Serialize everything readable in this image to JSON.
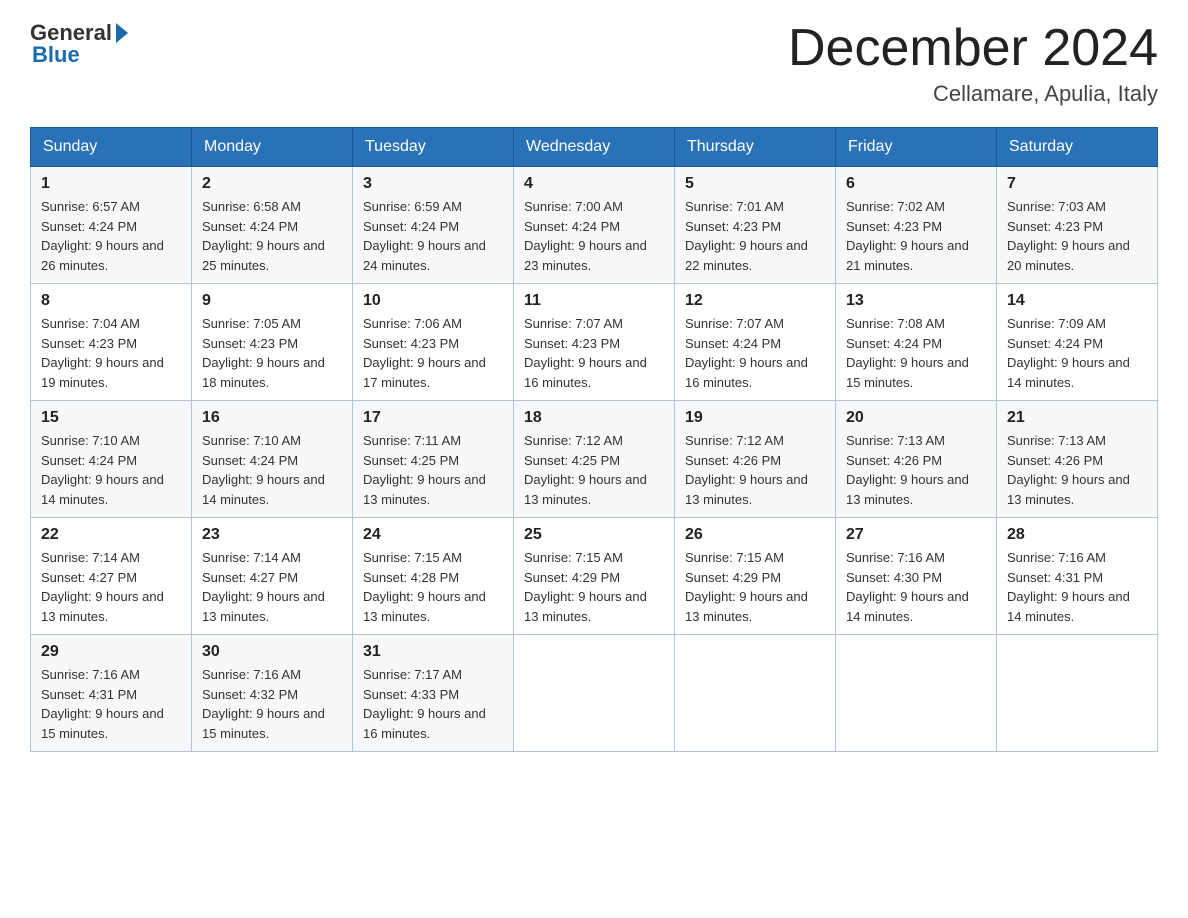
{
  "logo": {
    "general": "General",
    "blue": "Blue"
  },
  "header": {
    "title": "December 2024",
    "location": "Cellamare, Apulia, Italy"
  },
  "days_of_week": [
    "Sunday",
    "Monday",
    "Tuesday",
    "Wednesday",
    "Thursday",
    "Friday",
    "Saturday"
  ],
  "weeks": [
    [
      {
        "day": "1",
        "sunrise": "6:57 AM",
        "sunset": "4:24 PM",
        "daylight": "9 hours and 26 minutes."
      },
      {
        "day": "2",
        "sunrise": "6:58 AM",
        "sunset": "4:24 PM",
        "daylight": "9 hours and 25 minutes."
      },
      {
        "day": "3",
        "sunrise": "6:59 AM",
        "sunset": "4:24 PM",
        "daylight": "9 hours and 24 minutes."
      },
      {
        "day": "4",
        "sunrise": "7:00 AM",
        "sunset": "4:24 PM",
        "daylight": "9 hours and 23 minutes."
      },
      {
        "day": "5",
        "sunrise": "7:01 AM",
        "sunset": "4:23 PM",
        "daylight": "9 hours and 22 minutes."
      },
      {
        "day": "6",
        "sunrise": "7:02 AM",
        "sunset": "4:23 PM",
        "daylight": "9 hours and 21 minutes."
      },
      {
        "day": "7",
        "sunrise": "7:03 AM",
        "sunset": "4:23 PM",
        "daylight": "9 hours and 20 minutes."
      }
    ],
    [
      {
        "day": "8",
        "sunrise": "7:04 AM",
        "sunset": "4:23 PM",
        "daylight": "9 hours and 19 minutes."
      },
      {
        "day": "9",
        "sunrise": "7:05 AM",
        "sunset": "4:23 PM",
        "daylight": "9 hours and 18 minutes."
      },
      {
        "day": "10",
        "sunrise": "7:06 AM",
        "sunset": "4:23 PM",
        "daylight": "9 hours and 17 minutes."
      },
      {
        "day": "11",
        "sunrise": "7:07 AM",
        "sunset": "4:23 PM",
        "daylight": "9 hours and 16 minutes."
      },
      {
        "day": "12",
        "sunrise": "7:07 AM",
        "sunset": "4:24 PM",
        "daylight": "9 hours and 16 minutes."
      },
      {
        "day": "13",
        "sunrise": "7:08 AM",
        "sunset": "4:24 PM",
        "daylight": "9 hours and 15 minutes."
      },
      {
        "day": "14",
        "sunrise": "7:09 AM",
        "sunset": "4:24 PM",
        "daylight": "9 hours and 14 minutes."
      }
    ],
    [
      {
        "day": "15",
        "sunrise": "7:10 AM",
        "sunset": "4:24 PM",
        "daylight": "9 hours and 14 minutes."
      },
      {
        "day": "16",
        "sunrise": "7:10 AM",
        "sunset": "4:24 PM",
        "daylight": "9 hours and 14 minutes."
      },
      {
        "day": "17",
        "sunrise": "7:11 AM",
        "sunset": "4:25 PM",
        "daylight": "9 hours and 13 minutes."
      },
      {
        "day": "18",
        "sunrise": "7:12 AM",
        "sunset": "4:25 PM",
        "daylight": "9 hours and 13 minutes."
      },
      {
        "day": "19",
        "sunrise": "7:12 AM",
        "sunset": "4:26 PM",
        "daylight": "9 hours and 13 minutes."
      },
      {
        "day": "20",
        "sunrise": "7:13 AM",
        "sunset": "4:26 PM",
        "daylight": "9 hours and 13 minutes."
      },
      {
        "day": "21",
        "sunrise": "7:13 AM",
        "sunset": "4:26 PM",
        "daylight": "9 hours and 13 minutes."
      }
    ],
    [
      {
        "day": "22",
        "sunrise": "7:14 AM",
        "sunset": "4:27 PM",
        "daylight": "9 hours and 13 minutes."
      },
      {
        "day": "23",
        "sunrise": "7:14 AM",
        "sunset": "4:27 PM",
        "daylight": "9 hours and 13 minutes."
      },
      {
        "day": "24",
        "sunrise": "7:15 AM",
        "sunset": "4:28 PM",
        "daylight": "9 hours and 13 minutes."
      },
      {
        "day": "25",
        "sunrise": "7:15 AM",
        "sunset": "4:29 PM",
        "daylight": "9 hours and 13 minutes."
      },
      {
        "day": "26",
        "sunrise": "7:15 AM",
        "sunset": "4:29 PM",
        "daylight": "9 hours and 13 minutes."
      },
      {
        "day": "27",
        "sunrise": "7:16 AM",
        "sunset": "4:30 PM",
        "daylight": "9 hours and 14 minutes."
      },
      {
        "day": "28",
        "sunrise": "7:16 AM",
        "sunset": "4:31 PM",
        "daylight": "9 hours and 14 minutes."
      }
    ],
    [
      {
        "day": "29",
        "sunrise": "7:16 AM",
        "sunset": "4:31 PM",
        "daylight": "9 hours and 15 minutes."
      },
      {
        "day": "30",
        "sunrise": "7:16 AM",
        "sunset": "4:32 PM",
        "daylight": "9 hours and 15 minutes."
      },
      {
        "day": "31",
        "sunrise": "7:17 AM",
        "sunset": "4:33 PM",
        "daylight": "9 hours and 16 minutes."
      },
      null,
      null,
      null,
      null
    ]
  ]
}
